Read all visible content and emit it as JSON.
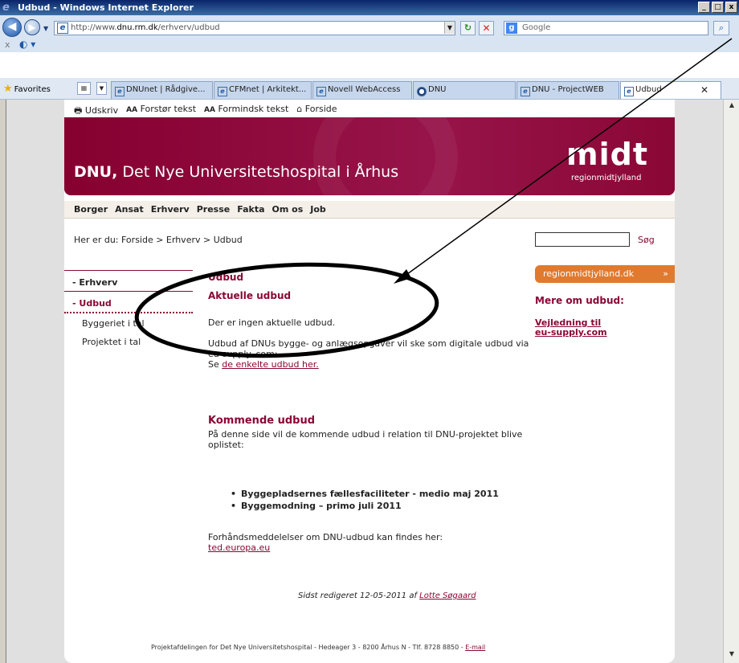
{
  "window": {
    "title": "Udbud - Windows Internet Explorer"
  },
  "address": {
    "url_prefix": "http://www.",
    "url_domain": "dnu.rm.dk",
    "url_path": "/erhverv/udbud",
    "search_placeholder": "Google"
  },
  "favorites_bar": {
    "label": "Favorites",
    "tabs": [
      {
        "label": "DNUnet | Rådgive..."
      },
      {
        "label": "CFMnet | Arkitekt..."
      },
      {
        "label": "Novell WebAccess"
      },
      {
        "label": "DNU"
      },
      {
        "label": "DNU - ProjectWEB"
      },
      {
        "label": "Udbud"
      }
    ]
  },
  "utilities": {
    "print": "Udskriv",
    "aa1": "AA",
    "enlarge": "Forstør tekst",
    "aa2": "AA",
    "shrink": "Formindsk tekst",
    "home": "Forside"
  },
  "banner": {
    "title_bold": "DNU,",
    "title_rest": " Det Nye Universitetshospital i Århus",
    "logo_word": "midt",
    "logo_sub": "regionmidtjylland"
  },
  "mainnav": [
    "Borger",
    "Ansat",
    "Erhverv",
    "Presse",
    "Fakta",
    "Om os",
    "Job"
  ],
  "breadcrumb": "Her er du: Forside > Erhverv > Udbud",
  "search": {
    "button": "Søg"
  },
  "leftnav": {
    "erhverv": "- Erhverv",
    "udbud": "- Udbud",
    "items": [
      "Byggeriet i tal",
      "Projektet i tal"
    ]
  },
  "content": {
    "h1": "Udbud",
    "h2": "Aktuelle udbud",
    "p1": "Der er ingen aktuelle udbud.",
    "p2": "Udbud af DNUs bygge- og anlægsopgaver vil ske som digitale udbud via eu-supply. com:",
    "p2_se": "Se ",
    "p2_link": "de enkelte udbud her.",
    "h3": "Kommende udbud",
    "p3": "På denne side vil de kommende udbud i relation til DNU-projektet blive oplistet:",
    "bullets": [
      "Byggepladsernes fællesfaciliteter - medio maj 2011",
      "Byggemodning – primo juli 2011"
    ],
    "p4": "Forhåndsmeddelelser om DNU-udbud kan findes her:",
    "p4_link": "ted.europa.eu",
    "edited_prefix": "Sidst redigeret 12-05-2011 af ",
    "edited_author": "Lotte Søgaard"
  },
  "right": {
    "box": "regionmidtjylland.dk",
    "heading": "Mere om udbud:",
    "link1": "Vejledning til",
    "link2": "eu-supply.com"
  },
  "footer": {
    "text": "Projektafdelingen for Det Nye Universitetshospital - Hedeager 3 - 8200 Århus N - Tlf. 8728 8850 - ",
    "email": "E-mail"
  },
  "colors": {
    "brand": "#8a0735",
    "accent_orange": "#e07a2e",
    "ie_blue": "#0a246a"
  }
}
